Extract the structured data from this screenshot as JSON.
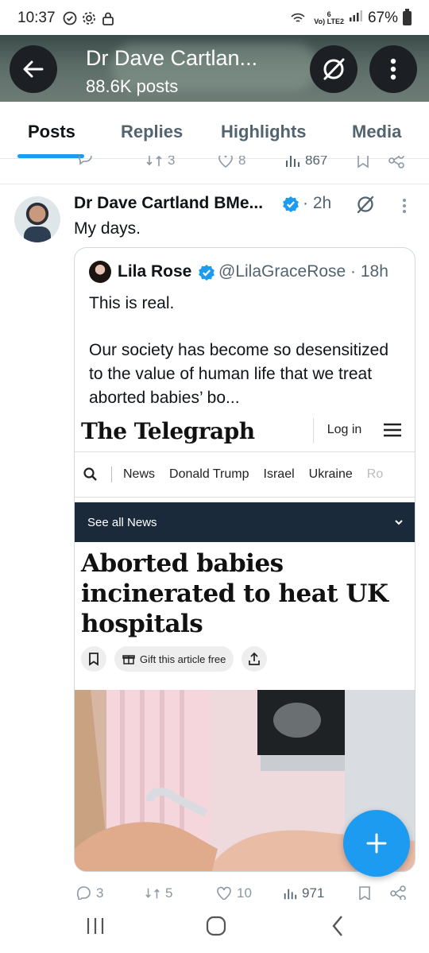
{
  "status_bar": {
    "time": "10:37",
    "network": "Vo) LTE2",
    "network_signal": "6",
    "battery": "67%"
  },
  "header": {
    "title": "Dr Dave Cartlan...",
    "posts_count": "88.6K posts"
  },
  "tabs": [
    "Posts",
    "Replies",
    "Highlights",
    "Media"
  ],
  "prev_tweet_actions": {
    "retweets": "3",
    "likes": "8",
    "views": "867"
  },
  "tweet": {
    "author": "Dr Dave Cartland BMe...",
    "time": "· 2h",
    "text": "My days."
  },
  "quote": {
    "name": "Lila Rose",
    "handle": "@LilaGraceRose · 18h",
    "text_line1": "This is real.",
    "text_line2": "Our society has become so desensitized to the value of human life that we treat aborted babies’ bo..."
  },
  "article": {
    "logo": "The Telegraph",
    "login": "Log in",
    "nav_items": [
      "News",
      "Donald Trump",
      "Israel",
      "Ukraine",
      "Ro"
    ],
    "see_all": "See all News",
    "headline": "Aborted babies incinerated to heat UK hospitals",
    "gift": "Gift this article free"
  },
  "tweet_actions": {
    "replies": "3",
    "retweets": "5",
    "likes": "10",
    "views": "971"
  },
  "colors": {
    "accent": "#1d9bf0",
    "verified": "#1d9bf0",
    "telegraph_bar": "#1b2a3a"
  },
  "icons": [
    "back-arrow-icon",
    "grok-icon",
    "more-icon",
    "verified-icon",
    "search-icon",
    "hamburger-icon",
    "bookmark-icon",
    "gift-icon",
    "share-icon",
    "compose-icon",
    "recents-icon",
    "home-icon",
    "back-nav-icon"
  ]
}
